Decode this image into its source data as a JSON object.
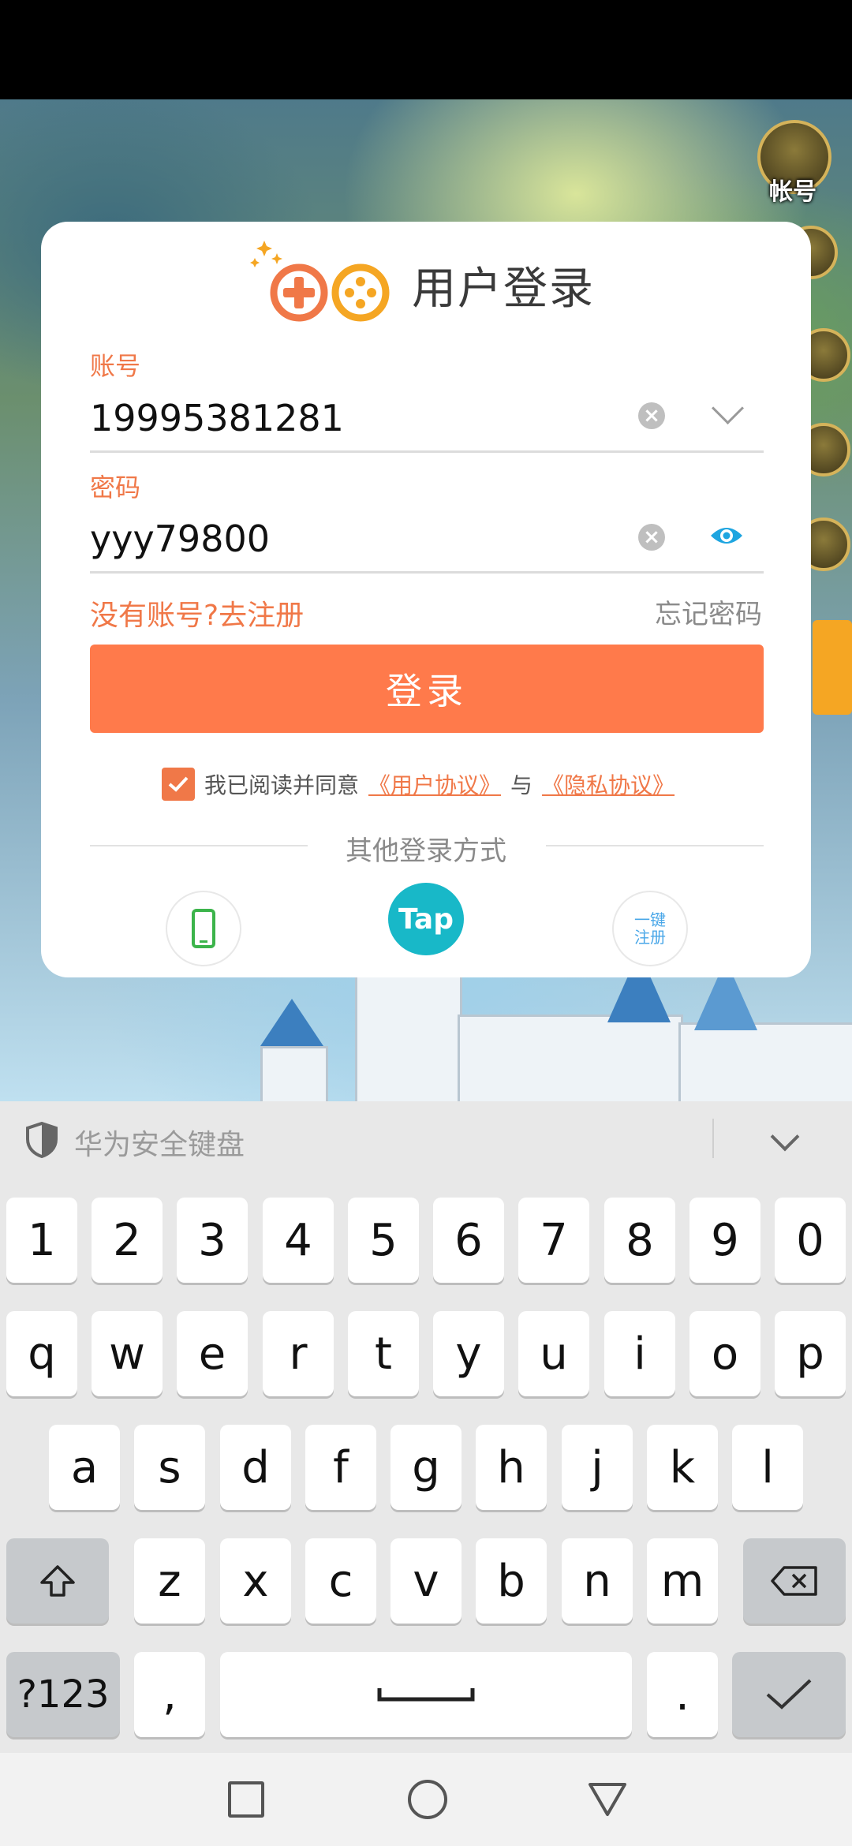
{
  "dialog": {
    "title": "用户登录",
    "account_label": "账号",
    "account_value": "19995381281",
    "password_label": "密码",
    "password_value": "yyy79800",
    "register_link": "没有账号?去注册",
    "forgot_link": "忘记密码",
    "login_button": "登录",
    "agree_text": "我已阅读并同意",
    "user_agreement": "《用户协议》",
    "and_text": "与",
    "privacy_policy": "《隐私协议》",
    "other_methods": "其他登录方式",
    "tap_label": "Tap",
    "onekey_line1": "一键",
    "onekey_line2": "注册",
    "colors": {
      "accent": "#ff7a4b",
      "label": "#f07848",
      "tap": "#18b8c8"
    }
  },
  "game_sidebar": {
    "account_label": "帐号"
  },
  "keyboard": {
    "title": "华为安全键盘",
    "row_numbers": [
      "1",
      "2",
      "3",
      "4",
      "5",
      "6",
      "7",
      "8",
      "9",
      "0"
    ],
    "row_q": [
      "q",
      "w",
      "e",
      "r",
      "t",
      "y",
      "u",
      "i",
      "o",
      "p"
    ],
    "row_a": [
      "a",
      "s",
      "d",
      "f",
      "g",
      "h",
      "j",
      "k",
      "l"
    ],
    "row_z": [
      "z",
      "x",
      "c",
      "v",
      "b",
      "n",
      "m"
    ],
    "symbols_key": "?123",
    "comma_key": ",",
    "period_key": "."
  }
}
